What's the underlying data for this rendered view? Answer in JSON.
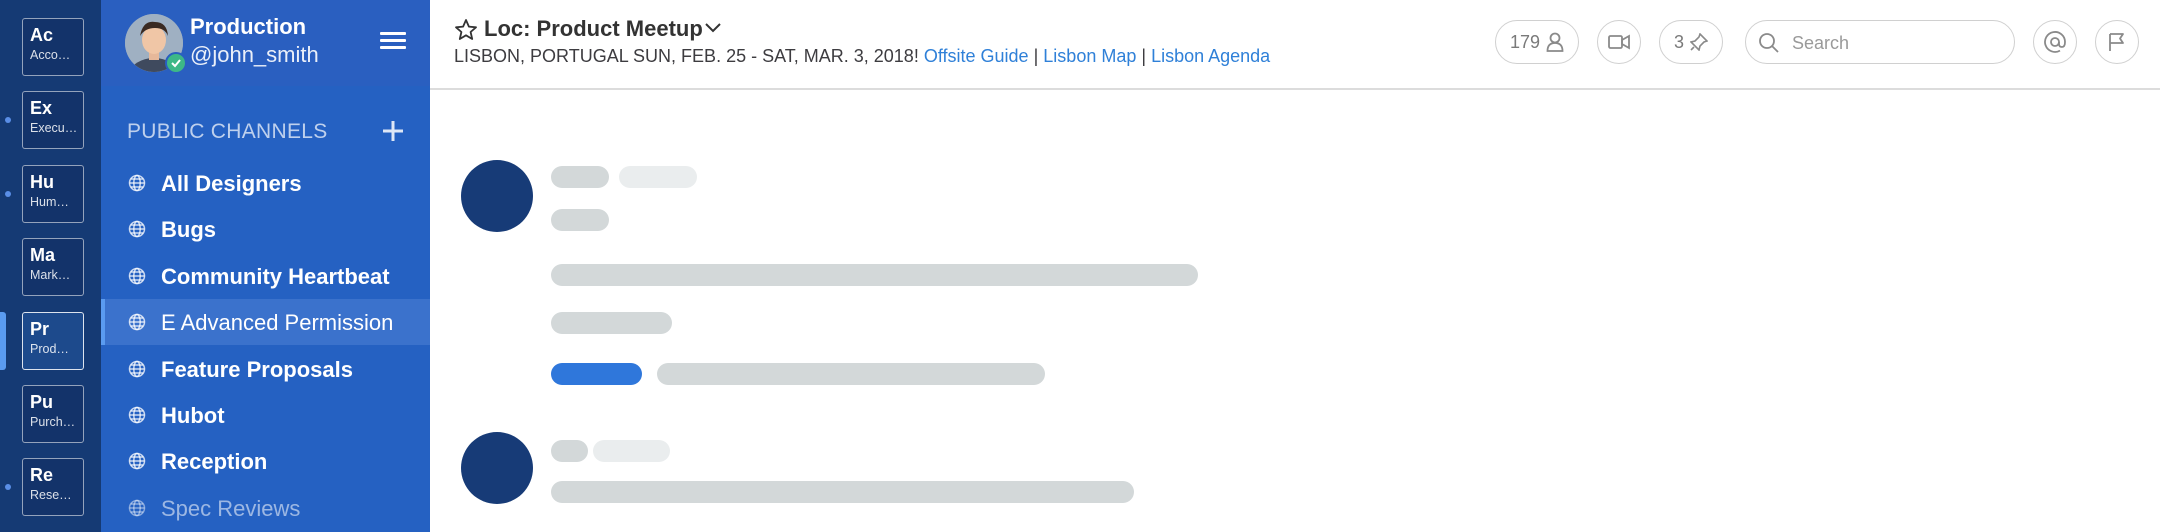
{
  "teams": [
    {
      "initials": "Ac",
      "name": "Acco…",
      "active": false,
      "unread": false
    },
    {
      "initials": "Ex",
      "name": "Execu…",
      "active": false,
      "unread": true
    },
    {
      "initials": "Hu",
      "name": "Hum…",
      "active": false,
      "unread": true
    },
    {
      "initials": "Ma",
      "name": "Mark…",
      "active": false,
      "unread": false
    },
    {
      "initials": "Pr",
      "name": "Prod…",
      "active": true,
      "unread": false
    },
    {
      "initials": "Pu",
      "name": "Purch…",
      "active": false,
      "unread": false
    },
    {
      "initials": "Re",
      "name": "Rese…",
      "active": false,
      "unread": true
    }
  ],
  "sidebar": {
    "team_name": "Production",
    "username": "@john_smith",
    "section_title": "PUBLIC CHANNELS",
    "channels": [
      {
        "label": "All Designers",
        "state": "unread"
      },
      {
        "label": "Bugs",
        "state": "unread"
      },
      {
        "label": "Community Heartbeat",
        "state": "unread"
      },
      {
        "label": "E Advanced Permission",
        "state": "active"
      },
      {
        "label": "Feature Proposals",
        "state": "unread"
      },
      {
        "label": "Hubot",
        "state": "unread"
      },
      {
        "label": "Reception",
        "state": "unread"
      },
      {
        "label": "Spec Reviews",
        "state": "muted"
      }
    ]
  },
  "header": {
    "channel_name": "Loc: Product Meetup",
    "purpose_text": "LISBON, PORTUGAL SUN, FEB. 25 - SAT, MAR. 3, 2018!",
    "links": [
      "Offsite Guide",
      "Lisbon Map",
      "Lisbon Agenda"
    ],
    "separator": "|",
    "member_count": "179",
    "pinned_count": "3",
    "search_placeholder": "Search"
  },
  "colors": {
    "team_sidebar": "#153a74",
    "channel_sidebar": "#2561c2",
    "link": "#2f80d8",
    "skeleton": "#d3d8d9",
    "accent": "#2f77db"
  }
}
